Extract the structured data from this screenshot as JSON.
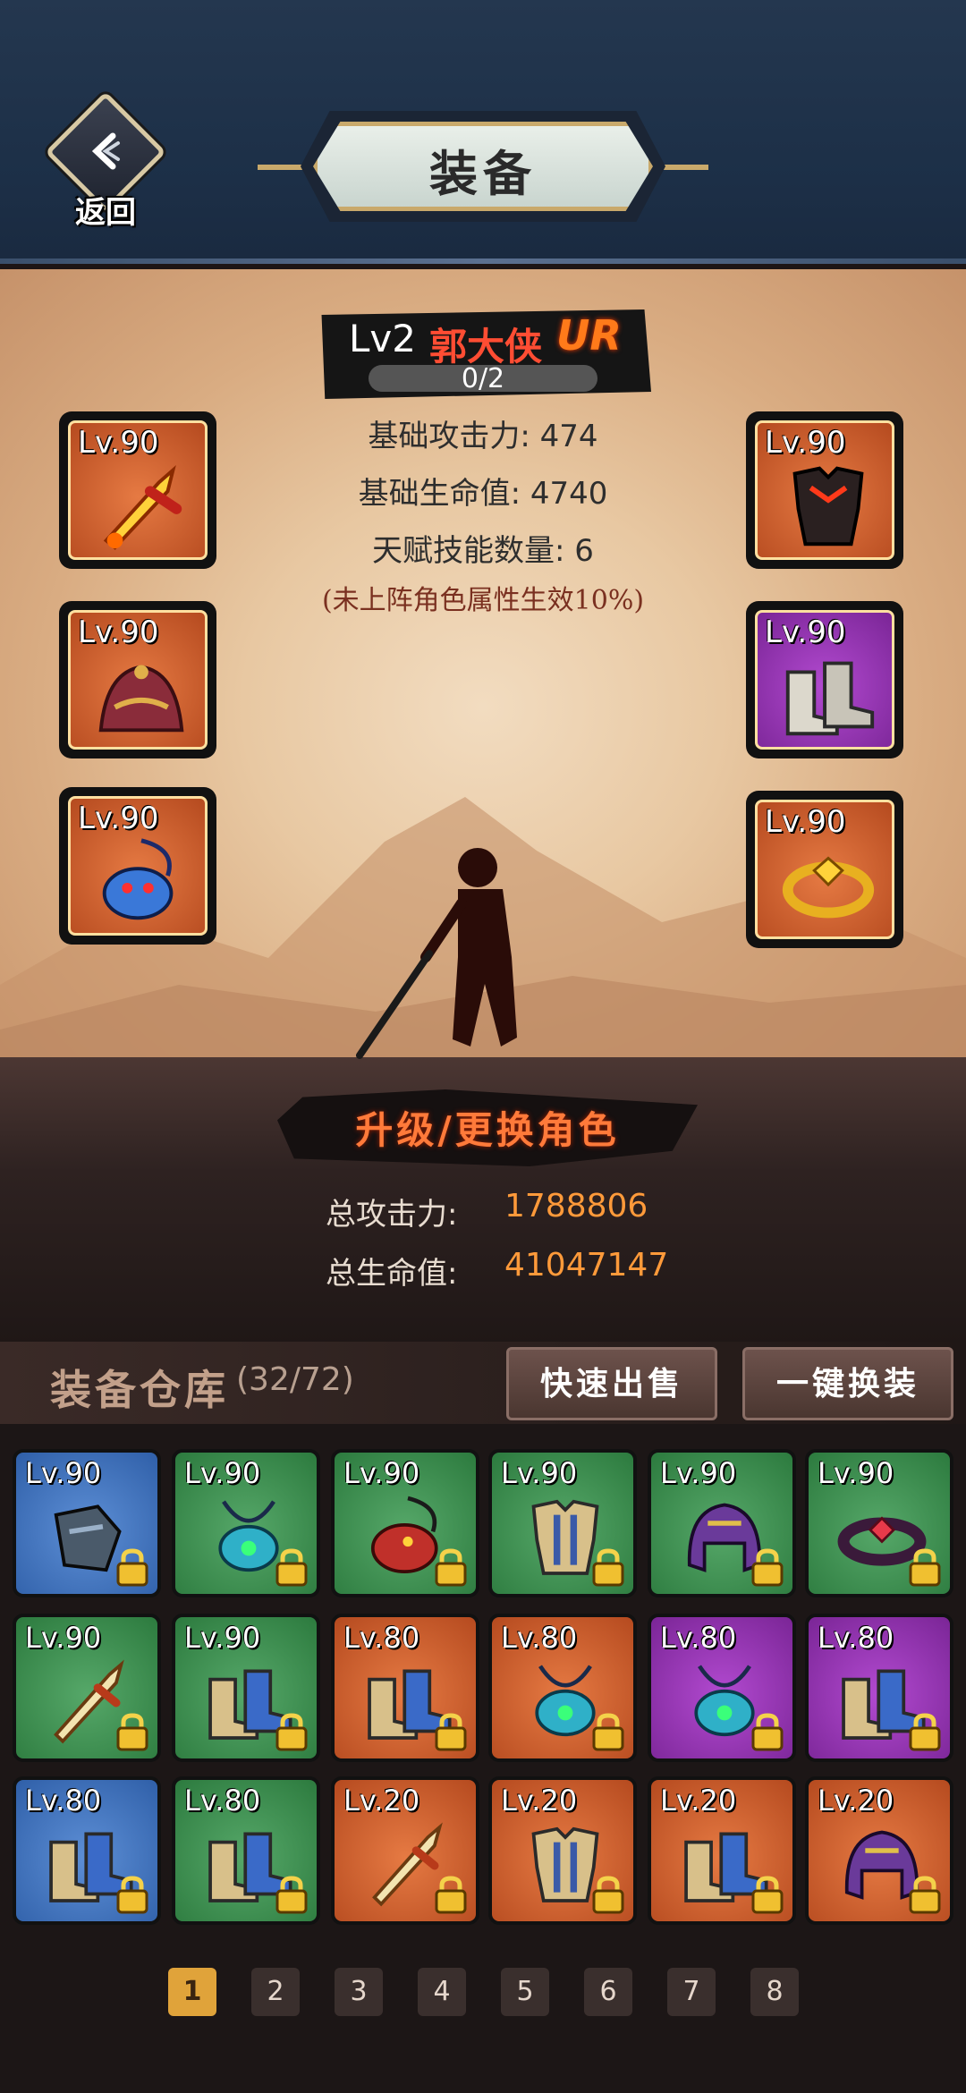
{
  "header": {
    "title": "装备",
    "back_label": "返回"
  },
  "hero": {
    "level": "Lv2",
    "name": "郭大侠",
    "rank": "UR",
    "exp": "0/2",
    "stats": [
      "基础攻击力: 474",
      "基础生命值: 4740",
      "天赋技能数量: 6"
    ],
    "note": "(未上阵角色属性生效10%)"
  },
  "equipped": [
    {
      "level": "Lv.90",
      "rarity": "orange",
      "icon": "sword-icon"
    },
    {
      "level": "Lv.90",
      "rarity": "orange",
      "icon": "hat-icon"
    },
    {
      "level": "Lv.90",
      "rarity": "orange",
      "icon": "dragon-necklace-icon"
    },
    {
      "level": "Lv.90",
      "rarity": "orange",
      "icon": "armor-icon"
    },
    {
      "level": "Lv.90",
      "rarity": "purple",
      "icon": "boots-icon"
    },
    {
      "level": "Lv.90",
      "rarity": "orange",
      "icon": "ring-icon"
    }
  ],
  "upgrade_label": "升级/更换角色",
  "totals": {
    "attack_label": "总攻击力:",
    "attack_value": "1788806",
    "hp_label": "总生命值:",
    "hp_value": "41047147"
  },
  "warehouse": {
    "title": "装备仓库",
    "count": "(32/72)",
    "quick_sell_label": "快速出售",
    "auto_equip_label": "一键换装"
  },
  "inventory": [
    {
      "level": "Lv.90",
      "rarity": "blue",
      "icon": "gauntlet-icon"
    },
    {
      "level": "Lv.90",
      "rarity": "green",
      "icon": "necklace-icon"
    },
    {
      "level": "Lv.90",
      "rarity": "green",
      "icon": "dragon-necklace-icon"
    },
    {
      "level": "Lv.90",
      "rarity": "green",
      "icon": "armor-icon"
    },
    {
      "level": "Lv.90",
      "rarity": "green",
      "icon": "helmet-icon"
    },
    {
      "level": "Lv.90",
      "rarity": "green",
      "icon": "ring-icon"
    },
    {
      "level": "Lv.90",
      "rarity": "green",
      "icon": "sword-icon"
    },
    {
      "level": "Lv.90",
      "rarity": "green",
      "icon": "boots-icon"
    },
    {
      "level": "Lv.80",
      "rarity": "orange",
      "icon": "boots-icon"
    },
    {
      "level": "Lv.80",
      "rarity": "orange",
      "icon": "necklace-icon"
    },
    {
      "level": "Lv.80",
      "rarity": "purple",
      "icon": "necklace-icon"
    },
    {
      "level": "Lv.80",
      "rarity": "purple",
      "icon": "boots-icon"
    },
    {
      "level": "Lv.80",
      "rarity": "blue",
      "icon": "boots-icon"
    },
    {
      "level": "Lv.80",
      "rarity": "green",
      "icon": "boots-icon"
    },
    {
      "level": "Lv.20",
      "rarity": "orange",
      "icon": "sword-icon"
    },
    {
      "level": "Lv.20",
      "rarity": "orange",
      "icon": "armor-icon"
    },
    {
      "level": "Lv.20",
      "rarity": "orange",
      "icon": "boots-icon"
    },
    {
      "level": "Lv.20",
      "rarity": "orange",
      "icon": "helmet-icon"
    }
  ],
  "pagination": {
    "pages": [
      "1",
      "2",
      "3",
      "4",
      "5",
      "6",
      "7",
      "8"
    ],
    "current": "1"
  }
}
